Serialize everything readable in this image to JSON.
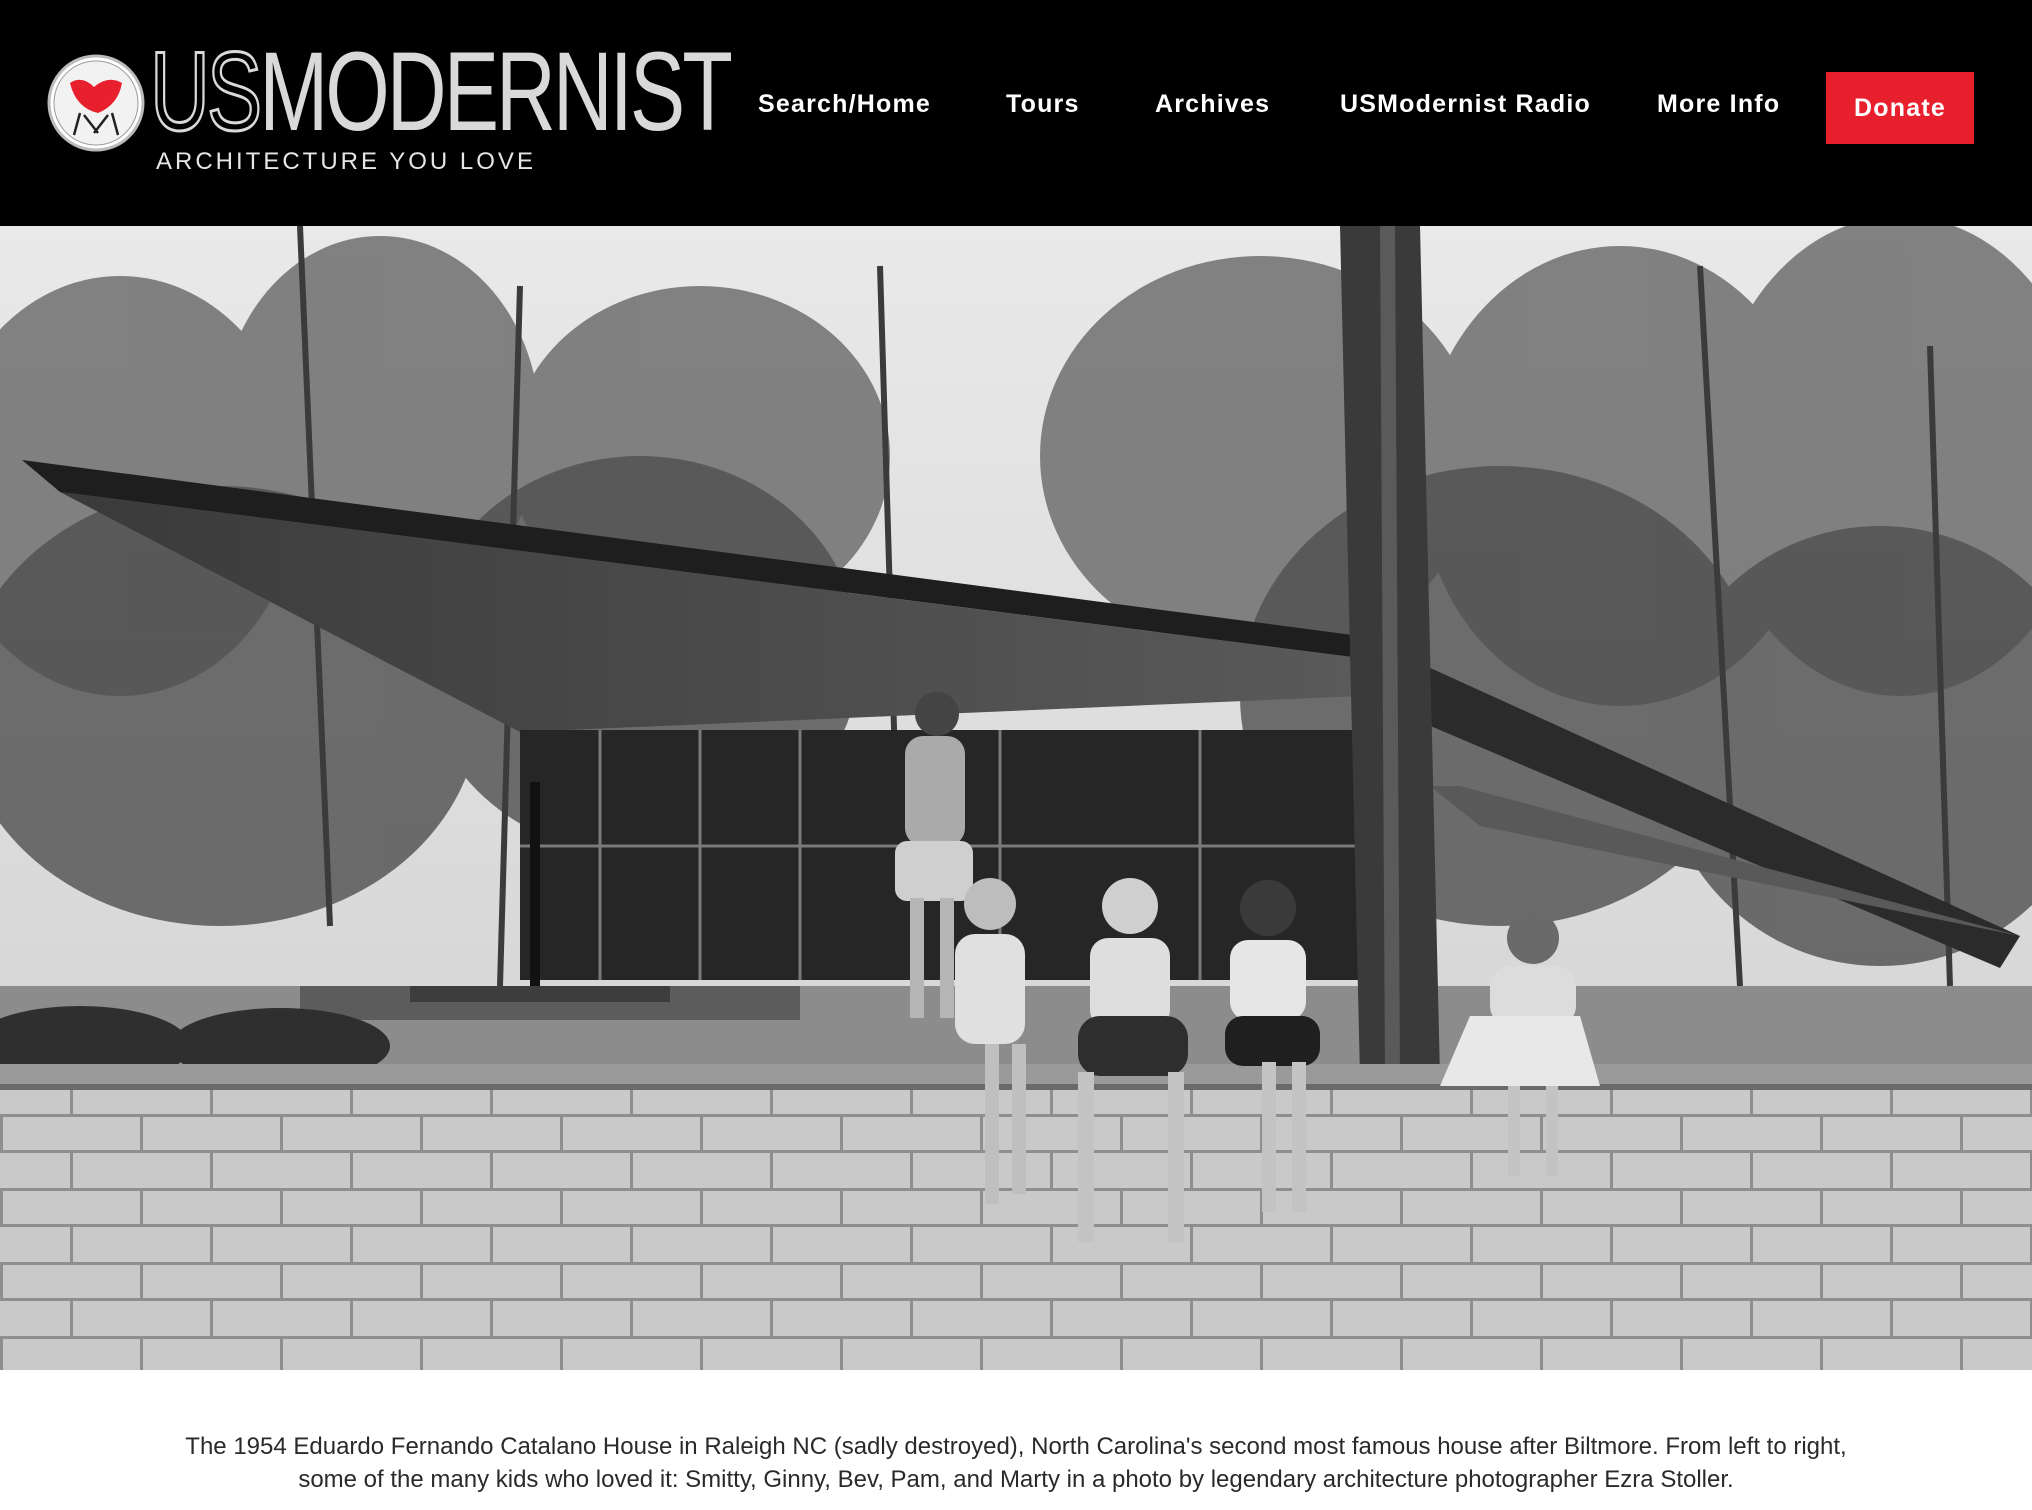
{
  "header": {
    "logo": {
      "wordmark_us": "US",
      "wordmark_rest": "MODERNIST",
      "tagline": "ARCHITECTURE YOU LOVE",
      "icon": "butterfly-chair-icon"
    },
    "nav": [
      {
        "label": "Search/Home"
      },
      {
        "label": "Tours"
      },
      {
        "label": "Archives"
      },
      {
        "label": "USModernist Radio"
      },
      {
        "label": "More Info"
      }
    ],
    "donate_label": "Donate"
  },
  "hero": {
    "image_subject": "black-and-white photo of children sitting on a cinder block wall in front of a modernist house with a swooping roof"
  },
  "caption": "The 1954 Eduardo Fernando Catalano House in Raleigh NC (sadly destroyed), North Carolina's second most famous house after Biltmore. From left to right, some of the many kids who loved it: Smitty, Ginny, Bev, Pam, and Marty in a photo by legendary architecture photographer Ezra Stoller.",
  "colors": {
    "header_bg": "#000000",
    "donate_bg": "#e8202e",
    "logo_gray": "#d9d9d9",
    "chair_red": "#e8202e"
  }
}
